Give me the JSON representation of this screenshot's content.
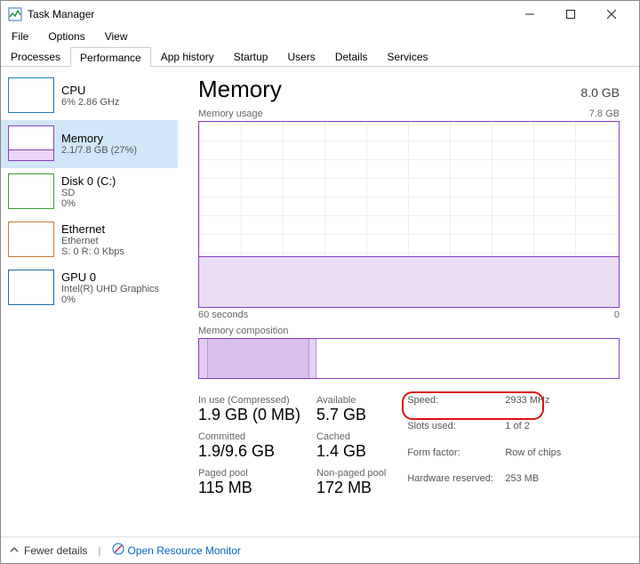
{
  "window": {
    "title": "Task Manager"
  },
  "menu": {
    "file": "File",
    "options": "Options",
    "view": "View"
  },
  "tabs": {
    "processes": "Processes",
    "performance": "Performance",
    "app_history": "App history",
    "startup": "Startup",
    "users": "Users",
    "details": "Details",
    "services": "Services"
  },
  "sidebar": {
    "cpu": {
      "title": "CPU",
      "sub": "6%  2.86 GHz"
    },
    "memory": {
      "title": "Memory",
      "sub": "2.1/7.8 GB (27%)"
    },
    "disk": {
      "title": "Disk 0 (C:)",
      "sub": "SD",
      "sub2": "0%"
    },
    "ethernet": {
      "title": "Ethernet",
      "sub": "Ethernet",
      "sub2": "S: 0  R: 0 Kbps"
    },
    "gpu": {
      "title": "GPU 0",
      "sub": "Intel(R) UHD Graphics",
      "sub2": "0%"
    }
  },
  "main": {
    "heading": "Memory",
    "total": "8.0 GB",
    "usage_label": "Memory usage",
    "usage_max": "7.8 GB",
    "xaxis_left": "60 seconds",
    "xaxis_right": "0",
    "comp_label": "Memory composition",
    "stats": {
      "in_use_lbl": "In use (Compressed)",
      "in_use_val": "1.9 GB (0 MB)",
      "avail_lbl": "Available",
      "avail_val": "5.7 GB",
      "commit_lbl": "Committed",
      "commit_val": "1.9/9.6 GB",
      "cached_lbl": "Cached",
      "cached_val": "1.4 GB",
      "paged_lbl": "Paged pool",
      "paged_val": "115 MB",
      "nonpaged_lbl": "Non-paged pool",
      "nonpaged_val": "172 MB"
    },
    "right": {
      "speed_lbl": "Speed:",
      "speed_val": "2933 MHz",
      "slots_lbl": "Slots used:",
      "slots_val": "1 of 2",
      "form_lbl": "Form factor:",
      "form_val": "Row of chips",
      "hw_lbl": "Hardware reserved:",
      "hw_val": "253 MB"
    }
  },
  "bottombar": {
    "fewer": "Fewer details",
    "link": "Open Resource Monitor"
  }
}
